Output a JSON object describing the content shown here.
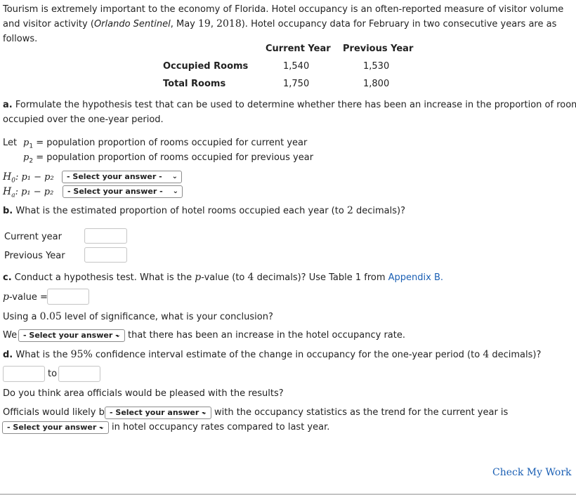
{
  "intro": {
    "text_before": "Tourism is extremely important to the economy of Florida. Hotel occupancy is an often-reported measure of visitor volume and visitor activity (",
    "source_italic": "Orlando Sentinel",
    "text_after_source": ", May ",
    "date_day": "19",
    "date_comma": ", ",
    "date_year": "2018",
    "text_end": "). Hotel occupancy data for February in two consecutive years are as follows."
  },
  "table": {
    "headers": [
      "Current Year",
      "Previous Year"
    ],
    "rows": [
      {
        "label": "Occupied Rooms",
        "current": "1,540",
        "previous": "1,530"
      },
      {
        "label": "Total Rooms",
        "current": "1,750",
        "previous": "1,800"
      }
    ]
  },
  "part_a": {
    "label": "a.",
    "question": " Formulate the hypothesis test that can be used to determine whether there has been an increase in the proportion of rooms",
    "question_cont": "occupied over the one-year period.",
    "let": "Let",
    "p1_sym": "p",
    "p1_sub": "1",
    "p1_def": "= population proportion of rooms occupied for current year",
    "p2_sym": "p",
    "p2_sub": "2",
    "p2_def": "= population proportion of rooms occupied for previous year",
    "h0_label": "H",
    "h0_sub": "0",
    "ha_label": "H",
    "ha_sub": "a",
    "hyp_expr": ": p₁ − p₂",
    "h0_select": "- Select your answer -",
    "ha_select": "- Select your answer -"
  },
  "part_b": {
    "label": "b.",
    "question_pre": " What is the estimated proportion of hotel rooms occupied each year (to ",
    "decimals": "2",
    "question_post": " decimals)?",
    "current_label": "Current year",
    "previous_label": "Previous Year",
    "current_value": "",
    "previous_value": ""
  },
  "part_c": {
    "label": "c.",
    "q_pre": " Conduct a hypothesis test. What is the ",
    "p_sym": "p",
    "q_mid": "-value (to ",
    "decimals": "4",
    "q_post": " decimals)? Use Table 1 from ",
    "appendix_link": "Appendix B.",
    "pvalue_label_sym": "p",
    "pvalue_label": "-value =",
    "pvalue_value": "",
    "sig_pre": "Using a ",
    "sig_level": "0.05",
    "sig_post": " level of significance, what is your conclusion?",
    "we": "We",
    "conclusion_select": "- Select your answer -",
    "conclusion_post": "that there has been an increase in the hotel occupancy rate."
  },
  "part_d": {
    "label": "d.",
    "q_pre": " What is the ",
    "conf": "95%",
    "q_mid": " confidence interval estimate of the change in occupancy for the one-year period (to ",
    "decimals": "4",
    "q_post": " decimals)?",
    "lower_value": "",
    "to": "to",
    "upper_value": "",
    "pleased_q": "Do you think area officials would be pleased with the results?",
    "officials_pre": "Officials would likely be",
    "officials_select": "- Select your answer -",
    "officials_post": "with the occupancy statistics as the trend for the current year is",
    "trend_select": "- Select your answer -",
    "trend_post": "in hotel occupancy rates compared to last year."
  },
  "footer": {
    "check_my_work": "Check My Work"
  },
  "colors": {
    "link": "#1a5fb4",
    "text": "#222222",
    "input_border": "#c8c8c8"
  }
}
